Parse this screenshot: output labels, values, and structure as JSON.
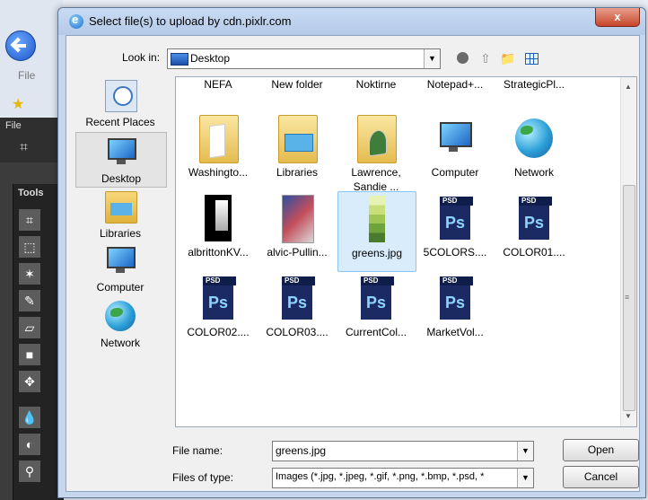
{
  "background": {
    "file_menu": "File",
    "pixlr_file_menu": "File",
    "tools_label": "Tools"
  },
  "dialog": {
    "title": "Select file(s) to upload by cdn.pixlr.com",
    "close_label": "x",
    "look_in_label": "Look in:",
    "look_in_value": "Desktop",
    "places": [
      {
        "label": "Recent Places",
        "icon": "recent-places-icon"
      },
      {
        "label": "Desktop",
        "icon": "desktop-icon",
        "selected": true
      },
      {
        "label": "Libraries",
        "icon": "libraries-icon"
      },
      {
        "label": "Computer",
        "icon": "computer-icon"
      },
      {
        "label": "Network",
        "icon": "network-icon"
      }
    ],
    "files": [
      {
        "label": "NEFA"
      },
      {
        "label": "New folder"
      },
      {
        "label": "Noktirne"
      },
      {
        "label": "Notepad+..."
      },
      {
        "label": "StrategicPl..."
      },
      {
        "label": "Washingto...",
        "icon": "folder-icon"
      },
      {
        "label": "Libraries",
        "icon": "libraries-folder-icon"
      },
      {
        "label": "Lawrence, Sandie ...",
        "icon": "user-folder-icon"
      },
      {
        "label": "Computer",
        "icon": "computer-icon"
      },
      {
        "label": "Network",
        "icon": "network-icon"
      },
      {
        "label": "albrittonKV...",
        "icon": "image-thumbnail-icon"
      },
      {
        "label": "alvic-Pullin...",
        "icon": "image-thumbnail-icon"
      },
      {
        "label": "greens.jpg",
        "icon": "image-thumbnail-icon",
        "selected": true
      },
      {
        "label": "5COLORS....",
        "icon": "psd-file-icon"
      },
      {
        "label": "COLOR01....",
        "icon": "psd-file-icon"
      },
      {
        "label": "COLOR02....",
        "icon": "psd-file-icon"
      },
      {
        "label": "COLOR03....",
        "icon": "psd-file-icon"
      },
      {
        "label": "CurrentCol...",
        "icon": "psd-file-icon"
      },
      {
        "label": "MarketVol...",
        "icon": "psd-file-icon"
      }
    ],
    "psd_tag": "PSD",
    "psd_glyph": "Ps",
    "file_name_label": "File name:",
    "file_name_value": "greens.jpg",
    "files_of_type_label": "Files of type:",
    "files_of_type_value": "Images (*.jpg, *.jpeg, *.gif, *.png, *.bmp, *.psd, *",
    "open_label": "Open",
    "cancel_label": "Cancel"
  },
  "colors": {
    "selection": "#d9ecfc",
    "title_bar": "#c9dbf3",
    "close_button": "#c7452a"
  }
}
